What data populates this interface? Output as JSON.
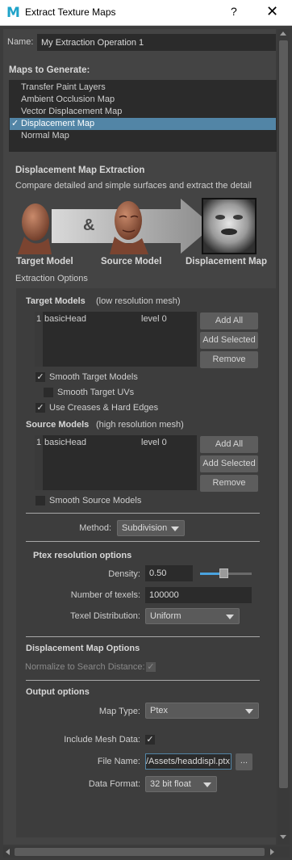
{
  "window": {
    "title": "Extract Texture Maps",
    "help": "?",
    "close": "✕"
  },
  "name": {
    "label": "Name:",
    "value": "My Extraction Operation 1"
  },
  "maps": {
    "header": "Maps to Generate:",
    "items": [
      {
        "label": "Transfer Paint Layers",
        "checked": false,
        "selected": false
      },
      {
        "label": "Ambient Occlusion Map",
        "checked": false,
        "selected": false
      },
      {
        "label": "Vector Displacement Map",
        "checked": false,
        "selected": false
      },
      {
        "label": "Displacement Map",
        "checked": true,
        "selected": true
      },
      {
        "label": "Normal Map",
        "checked": false,
        "selected": false
      }
    ]
  },
  "extraction": {
    "title": "Displacement Map Extraction",
    "description": "Compare detailed and simple surfaces and extract the detail",
    "ampersand": "&",
    "target_caption": "Target Model",
    "source_caption": "Source Model",
    "result_caption": "Displacement Map",
    "options_label": "Extraction Options"
  },
  "target_models": {
    "title": "Target Models",
    "subtitle": "(low resolution mesh)",
    "rows": [
      {
        "index": "1",
        "name": "basicHead",
        "level": "level 0"
      }
    ],
    "add_all": "Add All",
    "add_selected": "Add Selected",
    "remove": "Remove",
    "smooth_target_models": {
      "label": "Smooth Target Models",
      "checked": true
    },
    "smooth_target_uvs": {
      "label": "Smooth Target UVs",
      "checked": false
    },
    "use_creases": {
      "label": "Use Creases & Hard Edges",
      "checked": true
    }
  },
  "source_models": {
    "title": "Source Models",
    "subtitle": "(high resolution mesh)",
    "rows": [
      {
        "index": "1",
        "name": "basicHead",
        "level": "level 0"
      }
    ],
    "add_all": "Add All",
    "add_selected": "Add Selected",
    "remove": "Remove",
    "smooth_source_models": {
      "label": "Smooth Source Models",
      "checked": false
    }
  },
  "method": {
    "label": "Method:",
    "value": "Subdivision"
  },
  "ptex": {
    "title": "Ptex resolution options",
    "density_label": "Density:",
    "density_value": "0.50",
    "density_slider_fraction": 0.5,
    "texels_label": "Number of texels:",
    "texels_value": "100000",
    "distribution_label": "Texel Distribution:",
    "distribution_value": "Uniform"
  },
  "displacement_options": {
    "title": "Displacement Map Options",
    "normalize_label": "Normalize to Search Distance:",
    "normalize_checked": true
  },
  "output": {
    "title": "Output options",
    "map_type_label": "Map Type:",
    "map_type_value": "Ptex",
    "include_mesh_label": "Include Mesh Data:",
    "include_mesh_checked": true,
    "file_name_label": "File Name:",
    "file_name_value": "/Assets/headdispl.ptx",
    "browse_label": "...",
    "data_format_label": "Data Format:",
    "data_format_value": "32 bit float"
  },
  "colors": {
    "accent": "#1fa3c9",
    "selection": "#5285a6",
    "panel": "#444444",
    "field": "#2b2b2b",
    "slider": "#4aa3df"
  },
  "icons": {
    "check": "✓"
  }
}
